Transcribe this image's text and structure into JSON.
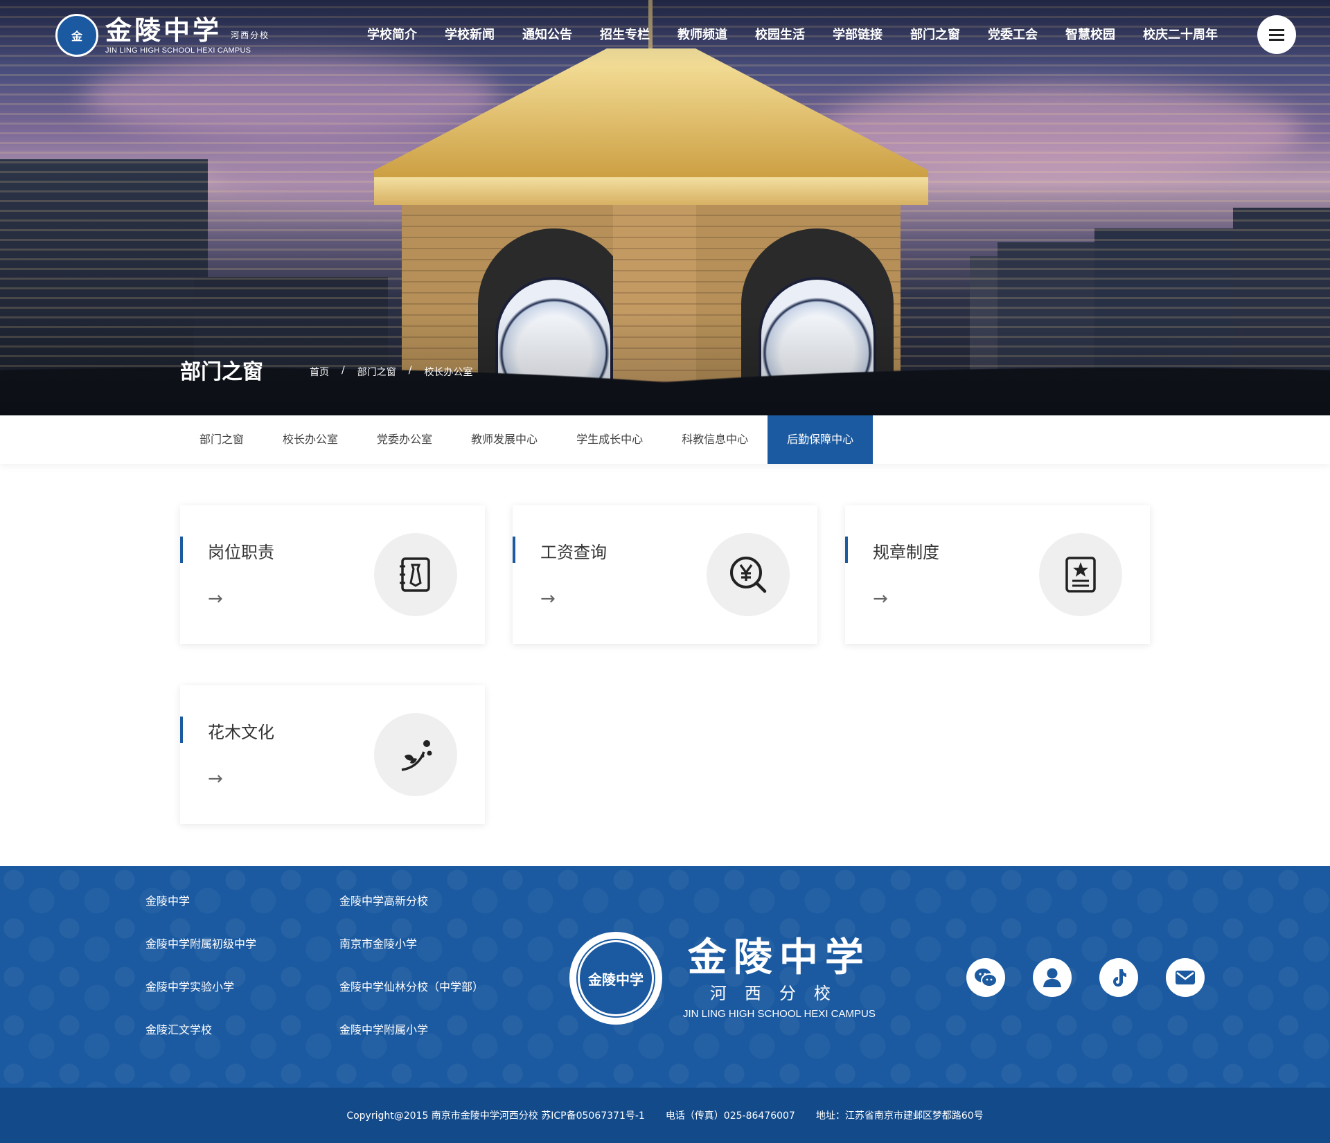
{
  "header": {
    "logo_cn": "金陵中学",
    "logo_sub": "河西分校",
    "logo_en": "JIN LING HIGH SCHOOL HEXI CAMPUS",
    "nav": [
      "学校简介",
      "学校新闻",
      "通知公告",
      "招生专栏",
      "教师频道",
      "校园生活",
      "学部链接",
      "部门之窗",
      "党委工会",
      "智慧校园",
      "校庆二十周年"
    ]
  },
  "hero": {
    "title": "部门之窗",
    "breadcrumb": [
      "首页",
      "/",
      "部门之窗",
      "/",
      "校长办公室"
    ]
  },
  "subnav": {
    "items": [
      "部门之窗",
      "校长办公室",
      "党委办公室",
      "教师发展中心",
      "学生成长中心",
      "科教信息中心",
      "后勤保障中心"
    ],
    "active_index": 6
  },
  "cards": [
    {
      "title": "岗位职责",
      "arrow": "→",
      "icon": "contact-book-icon"
    },
    {
      "title": "工资查询",
      "arrow": "→",
      "icon": "yuan-search-icon"
    },
    {
      "title": "规章制度",
      "arrow": "→",
      "icon": "star-document-icon"
    },
    {
      "title": "花木文化",
      "arrow": "→",
      "icon": "flower-icon"
    }
  ],
  "footer": {
    "links": [
      "金陵中学",
      "金陵中学高新分校",
      "金陵中学附属初级中学",
      "南京市金陵小学",
      "金陵中学实验小学",
      "金陵中学仙林分校（中学部）",
      "金陵汇文学校",
      "金陵中学附属小学"
    ],
    "brand_cn": "金陵中学",
    "brand_sub": "河西分校",
    "brand_en": "JIN LING HIGH SCHOOL HEXI CAMPUS",
    "seal_text": "金陵中学",
    "social": [
      "wechat-icon",
      "user-icon",
      "tiktok-icon",
      "mail-icon"
    ],
    "copyright": "Copyright@2015 南京市金陵中学河西分校  苏ICP备05067371号-1",
    "phone": "电话（传真）025-86476007",
    "address": "地址：江苏省南京市建邺区梦都路60号"
  },
  "colors": {
    "brand": "#1b5aa0",
    "footer_bottom": "#124a8a"
  }
}
